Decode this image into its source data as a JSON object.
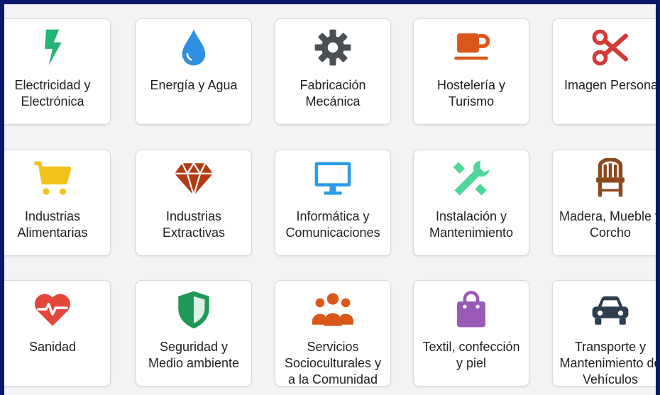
{
  "categories": [
    {
      "label": "Electricidad y\nElectrónica",
      "icon": "lightning-bolt-icon",
      "color": "#22b573"
    },
    {
      "label": "Energía y Agua",
      "icon": "water-drop-icon",
      "color": "#2f8fe0"
    },
    {
      "label": "Fabricación\nMecánica",
      "icon": "gear-icon",
      "color": "#4a4f55"
    },
    {
      "label": "Hostelería y\nTurismo",
      "icon": "coffee-cup-icon",
      "color": "#d9571a"
    },
    {
      "label": "Imagen Personal",
      "icon": "scissors-icon",
      "color": "#d23b36"
    },
    {
      "label": "Industrias\nAlimentarias",
      "icon": "shopping-cart-icon",
      "color": "#f2c21b"
    },
    {
      "label": "Industrias\nExtractivas",
      "icon": "diamond-icon",
      "color": "#b23a12"
    },
    {
      "label": "Informática y\nComunicaciones",
      "icon": "monitor-icon",
      "color": "#2b9ce8"
    },
    {
      "label": "Instalación y\nMantenimiento",
      "icon": "tools-icon",
      "color": "#4fd69a"
    },
    {
      "label": "Madera, Mueble y\nCorcho",
      "icon": "chair-icon",
      "color": "#8a4a1e"
    },
    {
      "label": "Sanidad",
      "icon": "heart-pulse-icon",
      "color": "#e4463c"
    },
    {
      "label": "Seguridad y\nMedio ambiente",
      "icon": "shield-icon",
      "color": "#1f9a55"
    },
    {
      "label": "Servicios\nSocioculturales y\na la Comunidad",
      "icon": "people-group-icon",
      "color": "#d9571a"
    },
    {
      "label": "Textil, confección\ny piel",
      "icon": "shopping-bag-icon",
      "color": "#9b59b6"
    },
    {
      "label": "Transporte y\nMantenimiento de\nVehículos",
      "icon": "car-icon",
      "color": "#2c3e50"
    }
  ]
}
